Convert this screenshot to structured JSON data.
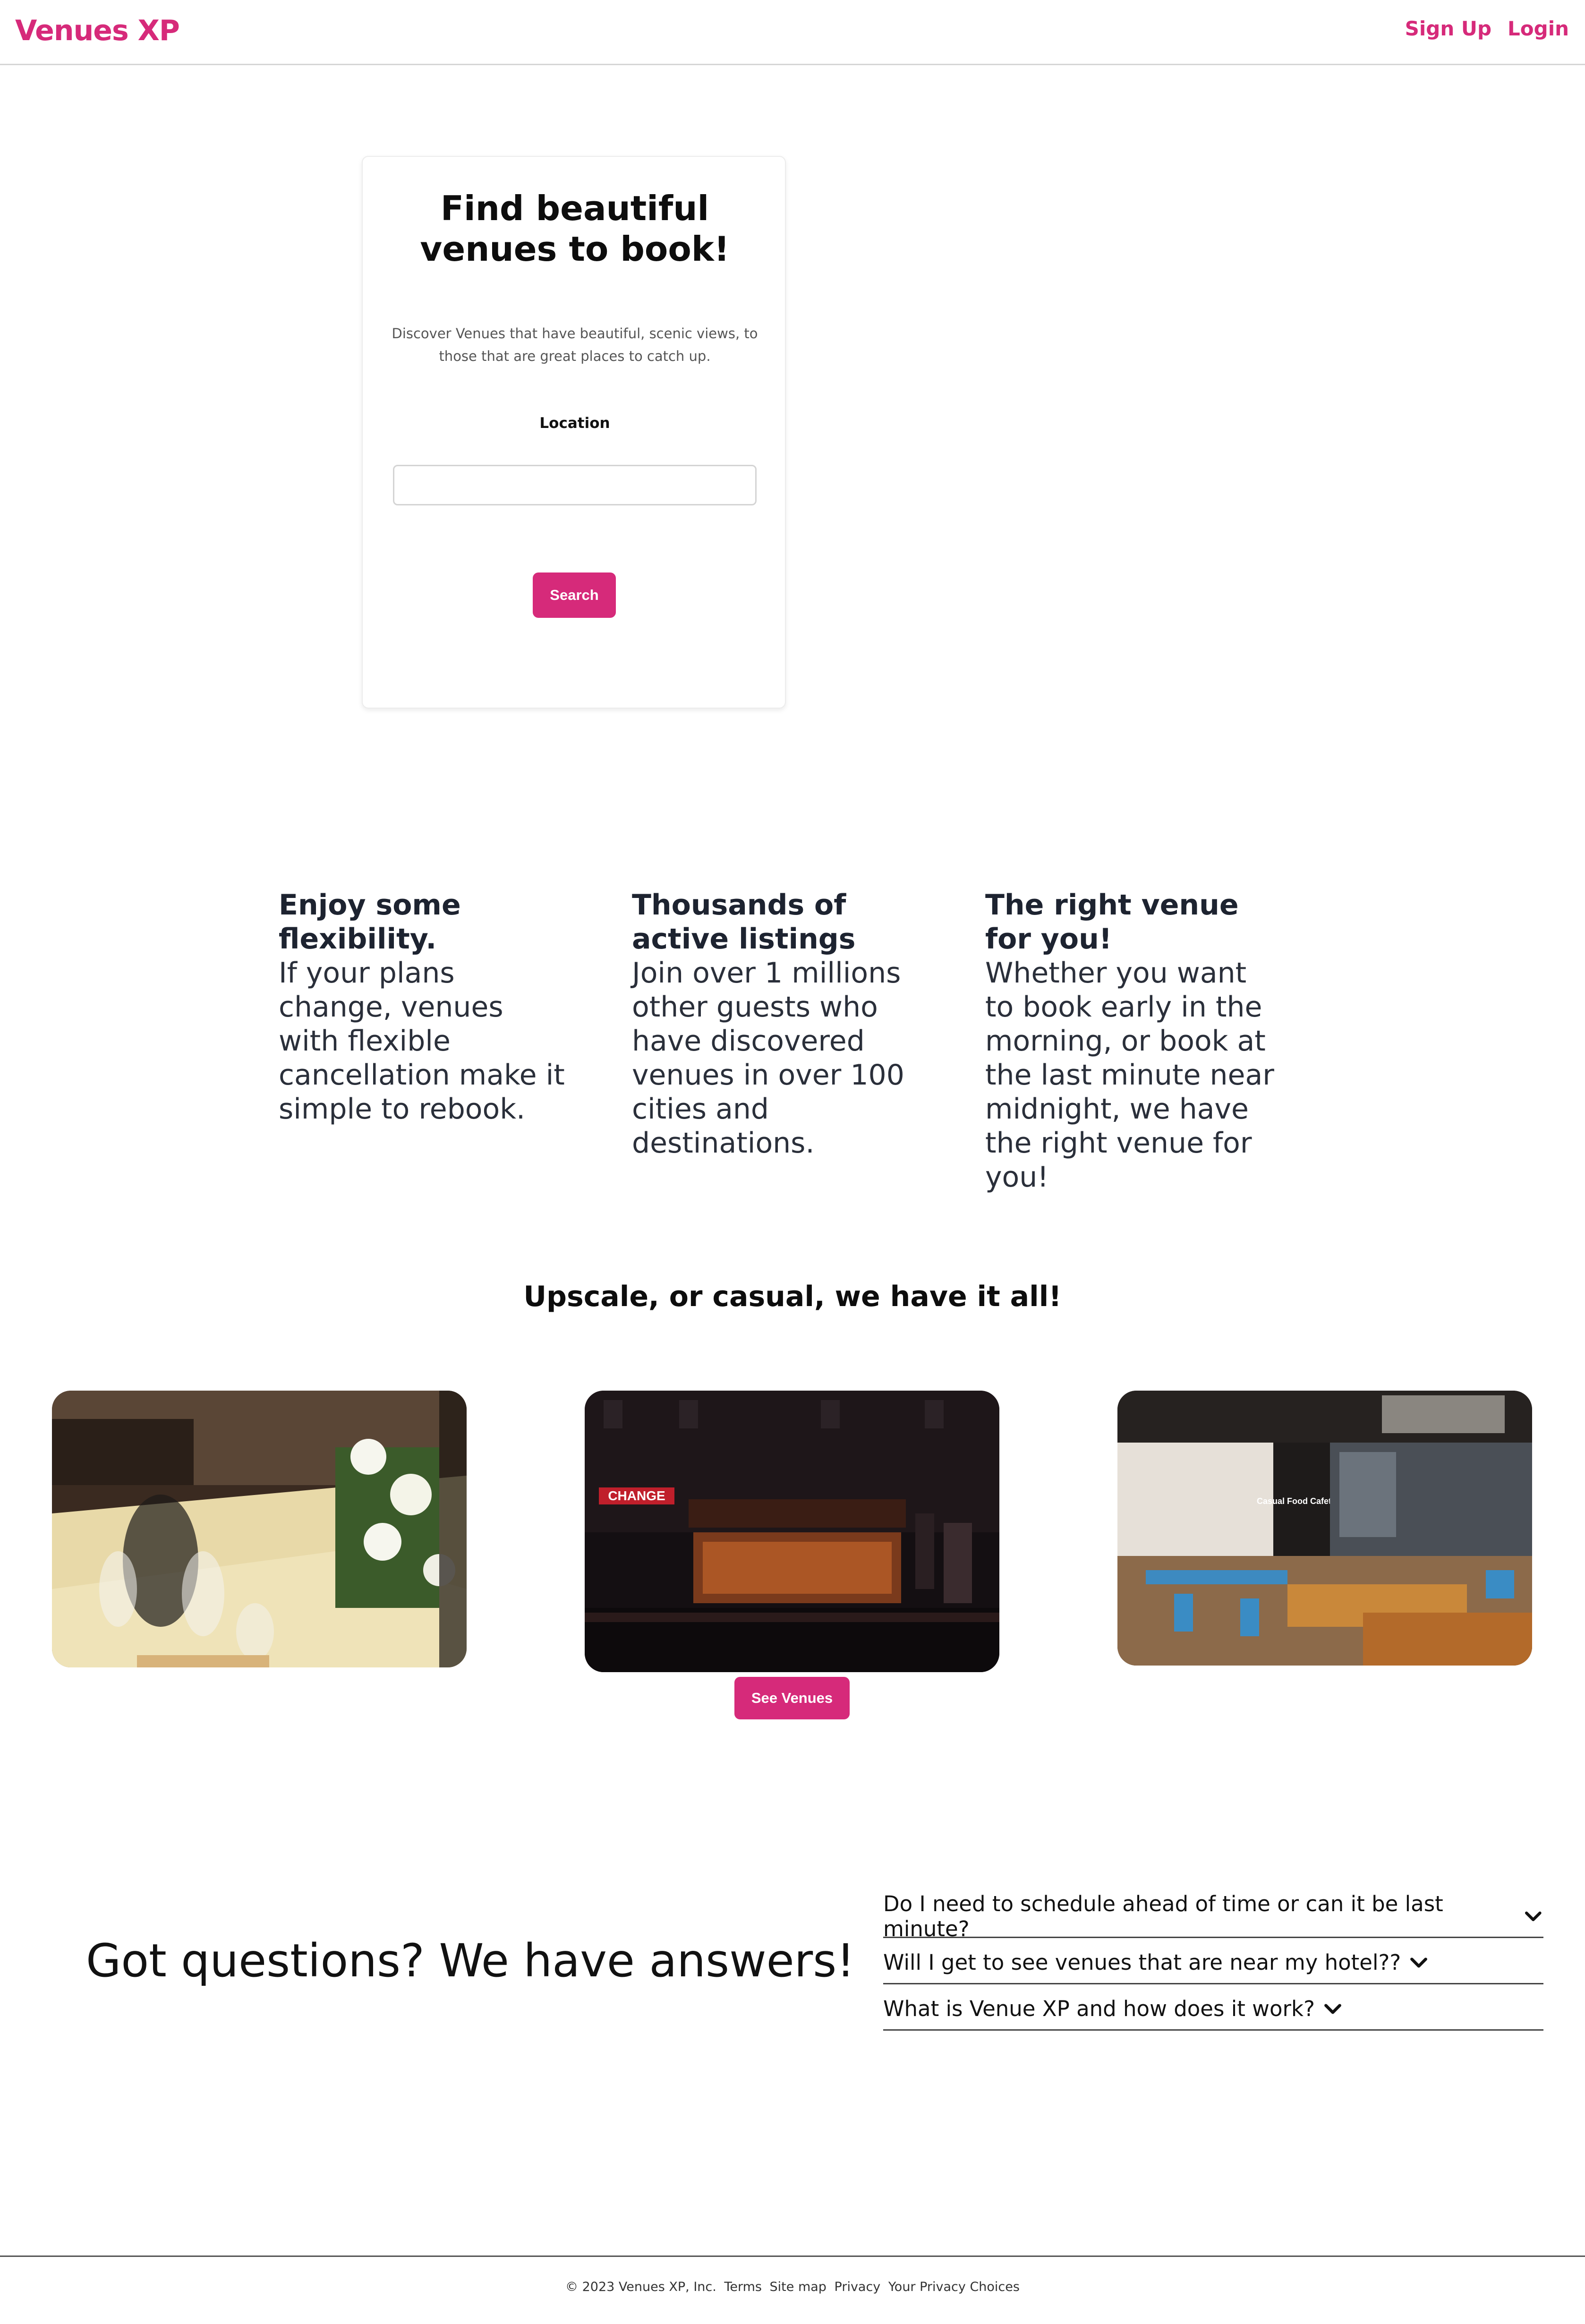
{
  "header": {
    "brand": "Venues XP",
    "signup_label": "Sign Up",
    "login_label": "Login"
  },
  "search_card": {
    "title": "Find beautiful venues to book!",
    "description": "Discover Venues that have beautiful, scenic views, to those that are great places to catch up.",
    "location_label": "Location",
    "location_value": "",
    "search_label": "Search"
  },
  "features": [
    {
      "title": "Enjoy some flexibility.",
      "body": "If your plans change, venues with flexible cancellation make it simple to rebook."
    },
    {
      "title": "Thousands of active listings",
      "body": "Join over 1 millions other guests who have discovered venues in over 100 cities and destinations."
    },
    {
      "title": "The right venue for you!",
      "body": "Whether you want to book early in the morning, or book at the last minute near midnight, we have the right venue for you!"
    }
  ],
  "gallery": {
    "title": "Upscale, or casual, we have it all!",
    "see_venues_label": "See Venues",
    "photo2_sign": "CHANGE",
    "photo3_sign": "Casual Food Cafeteria"
  },
  "faq": {
    "title": "Got questions? We have answers!",
    "items": [
      "Do I need to schedule ahead of time or can it be last minute?",
      "Will I get to see venues that are near my hotel??",
      "What is Venue XP and how does it work?"
    ]
  },
  "footer": {
    "copyright": "© 2023 Venues XP, Inc.",
    "links": [
      "Terms",
      "Site map",
      "Privacy",
      "Your Privacy Choices"
    ]
  },
  "colors": {
    "accent": "#d62a7a"
  }
}
